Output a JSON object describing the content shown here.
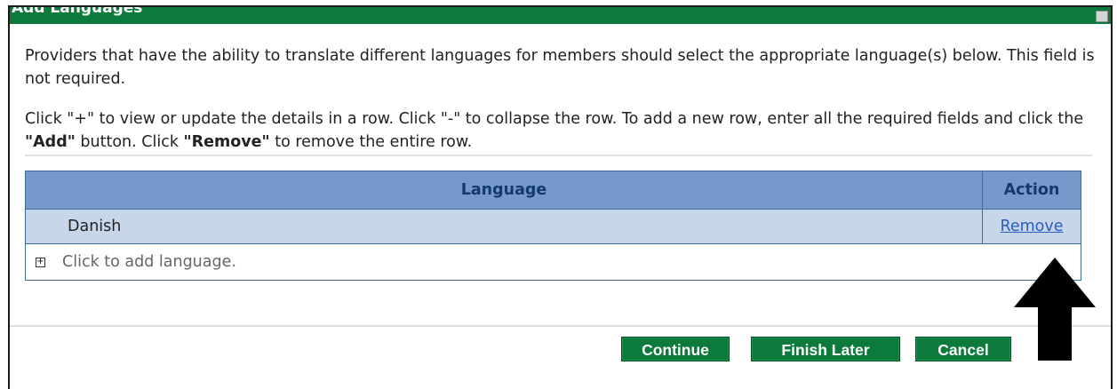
{
  "dialog": {
    "title": "Add Languages",
    "intro": "Providers that have the ability to translate different languages for members should select the appropriate language(s) below. This field is not required.",
    "instructions": {
      "part1": "Click \"+\" to view or update the details in a row. Click \"-\" to collapse the row. To add a new row, enter all the required fields and click the ",
      "add_bold": "\"Add\"",
      "part2": " button. Click ",
      "remove_bold": "\"Remove\"",
      "part3": " to remove the entire row."
    }
  },
  "table": {
    "headers": {
      "language": "Language",
      "action": "Action"
    },
    "rows": [
      {
        "language": "Danish",
        "action": "Remove"
      }
    ],
    "add_row_label": "Click to add language.",
    "add_row_icon": "plus-box-icon"
  },
  "buttons": {
    "continue": "Continue",
    "finish_later": "Finish Later",
    "cancel": "Cancel"
  },
  "colors": {
    "titlebar": "#0b7a3a",
    "header_bg": "#7699c9",
    "row_bg": "#c8d6ea",
    "button_bg": "#0b7a3a",
    "link": "#2a5dbd"
  }
}
